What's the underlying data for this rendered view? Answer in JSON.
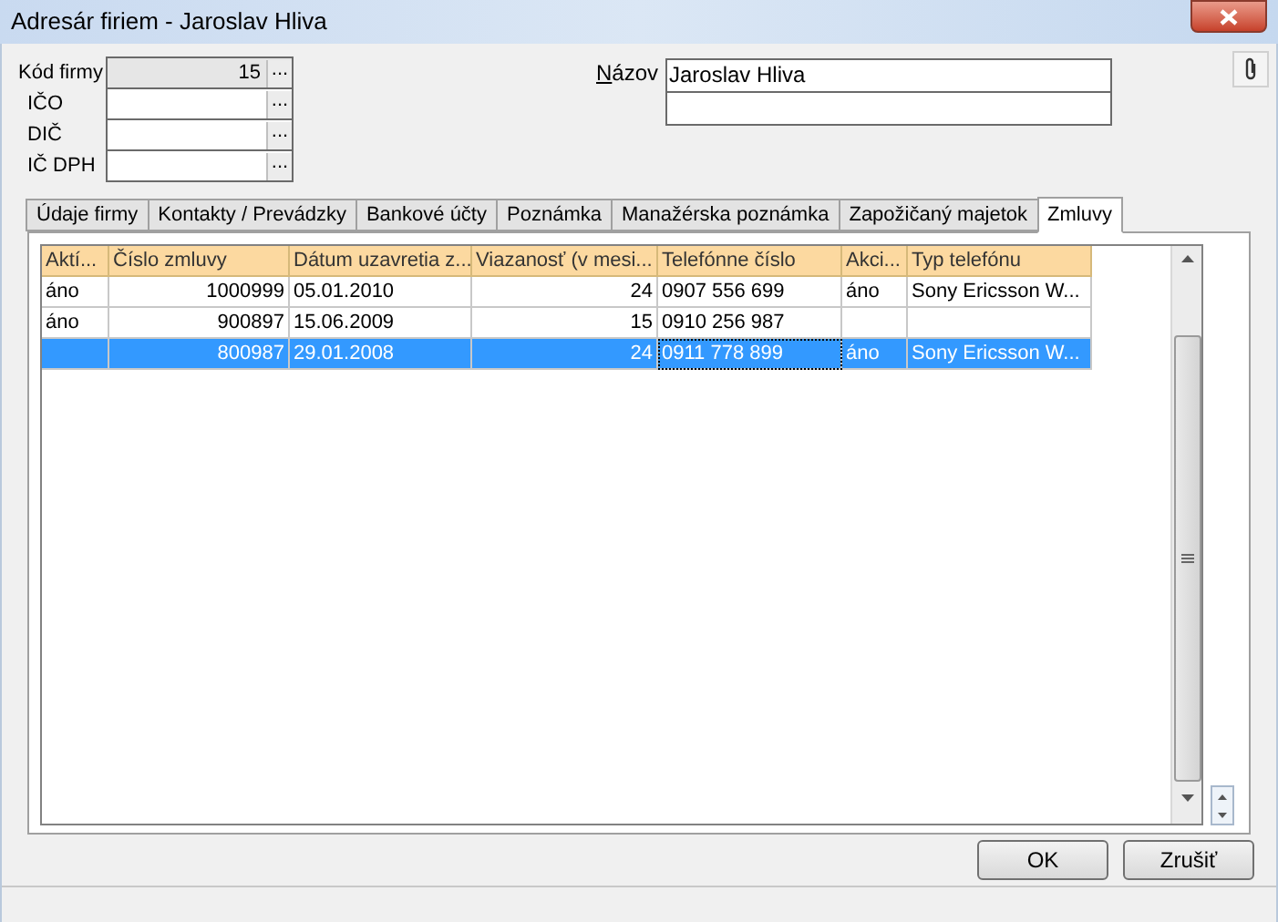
{
  "window": {
    "title": "Adresár firiem - Jaroslav Hliva"
  },
  "fields": [
    {
      "label": "Kód firmy",
      "value": "15",
      "readonly": true,
      "button": "..."
    },
    {
      "label": "IČO",
      "readonly": false,
      "button": "..."
    },
    {
      "label": "DIČ",
      "readonly": false,
      "button": "..."
    },
    {
      "label": "IČ DPH",
      "readonly": false,
      "button": "..."
    }
  ],
  "name_field": {
    "label_access_key": "N",
    "label_rest": "ázov",
    "lines": [
      "Jaroslav Hliva"
    ]
  },
  "tabs": [
    {
      "label": "Údaje firmy",
      "selected": false
    },
    {
      "label": "Kontakty / Prevádzky",
      "selected": false
    },
    {
      "label": "Bankové účty",
      "selected": false
    },
    {
      "label": "Poznámka",
      "selected": false
    },
    {
      "label": "Manažérska poznámka",
      "selected": false
    },
    {
      "label": "Zapožičaný majetok",
      "selected": false
    },
    {
      "label": "Zmluvy",
      "selected": true
    }
  ],
  "table": {
    "columns": [
      "Aktí...",
      "Číslo zmluvy",
      "Dátum uzavretia z...",
      "Viazanosť (v mesi...",
      "Telefónne číslo",
      "Akci...",
      "Typ telefónu"
    ],
    "rows": [
      {
        "selected": false,
        "cells": [
          "áno",
          "1000999",
          "05.01.2010",
          "24",
          "0907 556 699",
          "áno",
          "Sony Ericsson W..."
        ]
      },
      {
        "selected": false,
        "cells": [
          "áno",
          "900897",
          "15.06.2009",
          "15",
          "0910 256 987",
          "",
          ""
        ]
      },
      {
        "selected": true,
        "cells": [
          "",
          "800987",
          "29.01.2008",
          "24",
          "0911 778 899",
          "áno",
          "Sony Ericsson W..."
        ]
      }
    ]
  },
  "buttons": [
    "OK",
    "Zrušiť"
  ]
}
